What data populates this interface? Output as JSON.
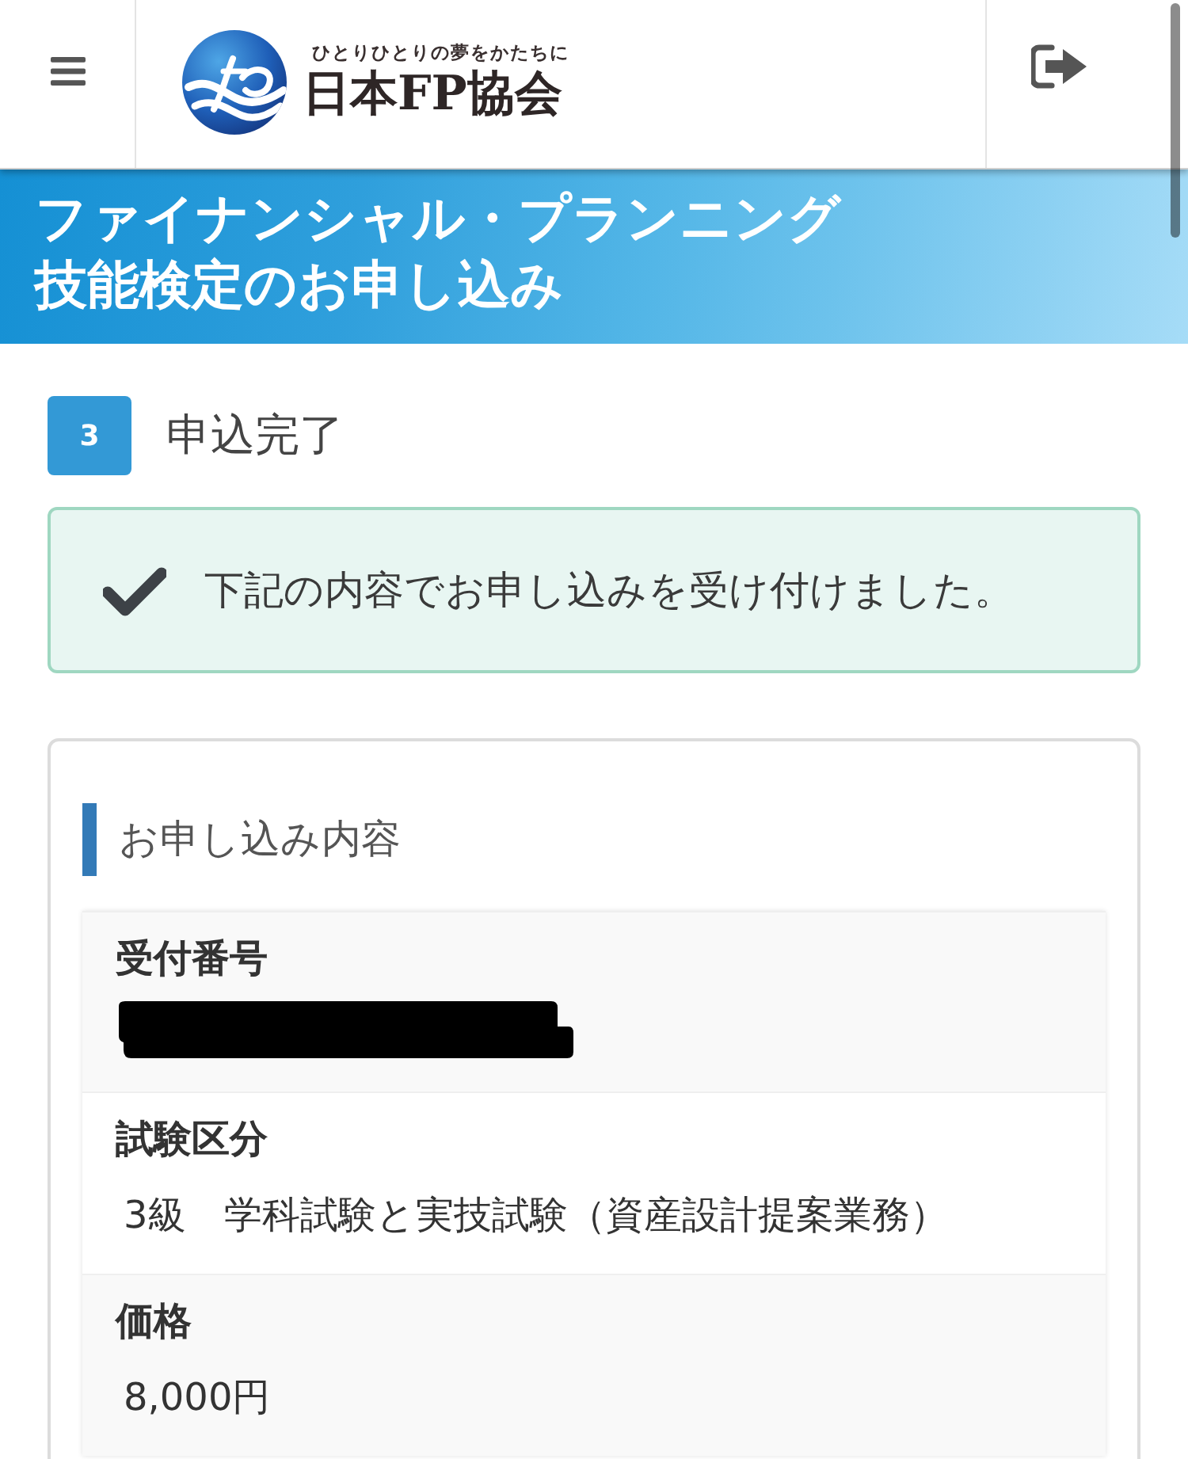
{
  "header": {
    "logo": {
      "tagline": "ひとりひとりの夢をかたちに",
      "name": "日本FP協会"
    }
  },
  "banner": {
    "title": "ファイナンシャル・プランニング技能検定のお申し込み"
  },
  "step": {
    "number": "3",
    "title": "申込完了"
  },
  "alert": {
    "kind": "success",
    "message": "下記の内容でお申し込みを受け付けました。"
  },
  "details": {
    "heading": "お申し込み内容",
    "rows": [
      {
        "label": "受付番号",
        "redacted": true
      },
      {
        "label": "試験区分",
        "value": "3級　学科試験と実技試験（資産設計提案業務）",
        "redacted": false
      },
      {
        "label": "価格",
        "value": "8,000円",
        "redacted": false
      }
    ]
  }
}
